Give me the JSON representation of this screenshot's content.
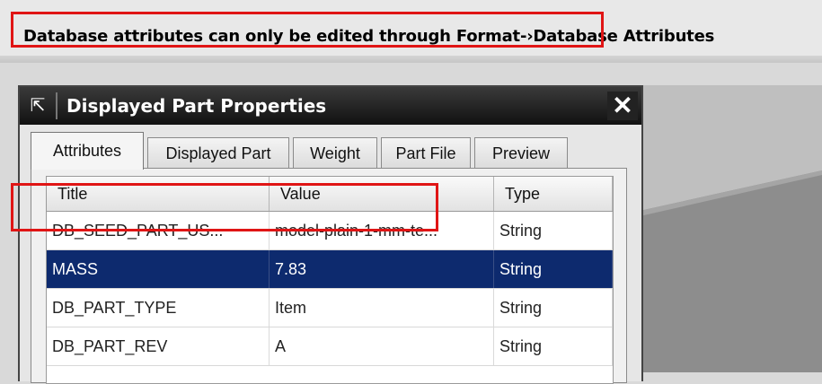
{
  "message_bar": {
    "text": "Database attributes can only be edited through Format-›Database Attributes"
  },
  "dialog": {
    "title": "Displayed Part Properties",
    "close_glyph": "✕",
    "pin_glyph": "⇱",
    "tabs": [
      {
        "label": "Attributes",
        "active": true
      },
      {
        "label": "Displayed Part",
        "active": false
      },
      {
        "label": "Weight",
        "active": false
      },
      {
        "label": "Part File",
        "active": false
      },
      {
        "label": "Preview",
        "active": false
      }
    ],
    "table": {
      "columns": [
        "Title",
        "Value",
        "Type"
      ],
      "rows": [
        {
          "title": "DB_SEED_PART_US...",
          "value": "model-plain-1-mm-te...",
          "type": "String",
          "selected": false
        },
        {
          "title": "MASS",
          "value": "7.83",
          "type": "String",
          "selected": true
        },
        {
          "title": "DB_PART_TYPE",
          "value": "Item",
          "type": "String",
          "selected": false
        },
        {
          "title": "DB_PART_REV",
          "value": "A",
          "type": "String",
          "selected": false
        }
      ]
    }
  },
  "colors": {
    "selection": "#0d2a6e",
    "callout": "#e01515",
    "titlebar": "#111111"
  },
  "icons": {
    "pin": "pin-icon",
    "close": "close-icon"
  }
}
